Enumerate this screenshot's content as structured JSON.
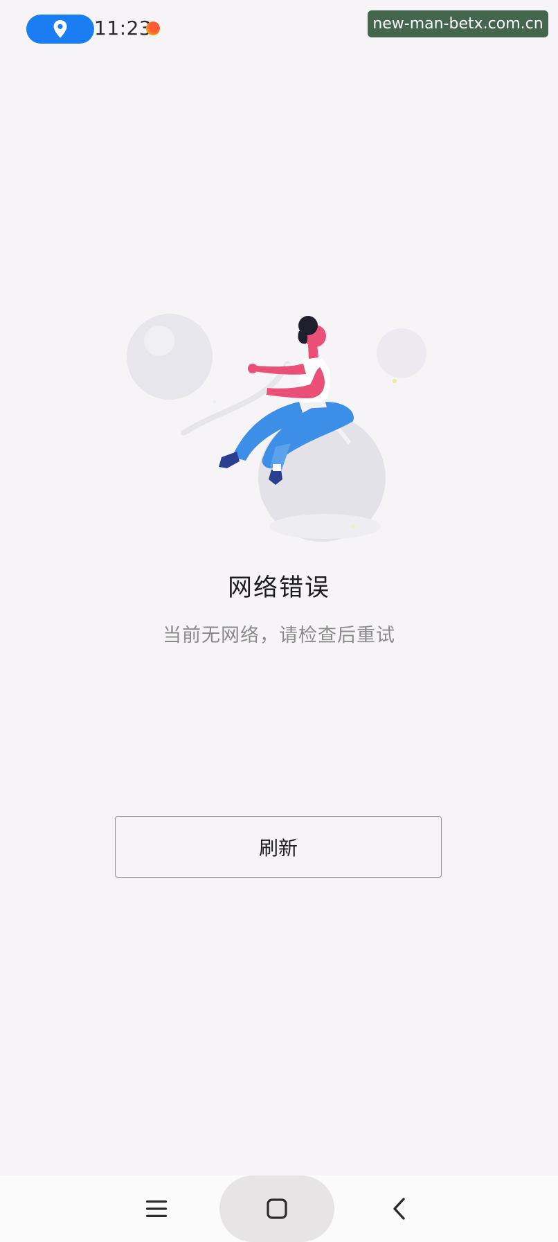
{
  "status_bar": {
    "time": "11:23",
    "location_icon": "location-pin-icon",
    "watermark": "new-man-betx.com.cn"
  },
  "main": {
    "title": "网络错误",
    "subtitle": "当前无网络，请检查后重试",
    "refresh_label": "刷新"
  },
  "nav_bar": {
    "icons": [
      "menu-icon",
      "home-icon",
      "back-icon"
    ]
  },
  "colors": {
    "background": "#f6f4f7",
    "location_pill": "#1a7ef2",
    "figure_skin": "#ea4f77",
    "figure_pants": "#3d8ee6",
    "figure_shoes": "#2a3f8f"
  }
}
